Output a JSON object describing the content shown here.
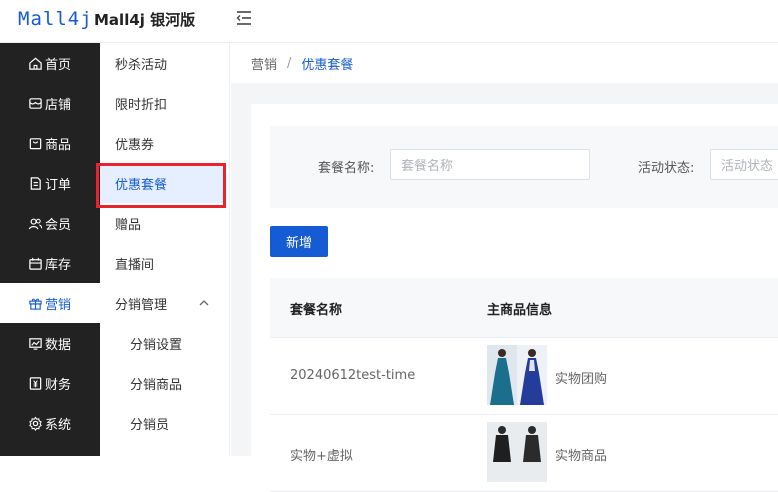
{
  "header": {
    "logo": "Mall4j",
    "title": "Mall4j 银河版"
  },
  "sidebar_main": [
    {
      "label": "首页",
      "icon": "home-icon"
    },
    {
      "label": "店铺",
      "icon": "store-icon"
    },
    {
      "label": "商品",
      "icon": "goods-icon"
    },
    {
      "label": "订单",
      "icon": "order-icon"
    },
    {
      "label": "会员",
      "icon": "member-icon"
    },
    {
      "label": "库存",
      "icon": "inventory-icon"
    },
    {
      "label": "营销",
      "icon": "gift-icon",
      "active": true
    },
    {
      "label": "数据",
      "icon": "chart-icon"
    },
    {
      "label": "财务",
      "icon": "finance-icon"
    },
    {
      "label": "系统",
      "icon": "settings-icon"
    }
  ],
  "sidebar_sub": [
    {
      "label": "秒杀活动"
    },
    {
      "label": "限时折扣"
    },
    {
      "label": "优惠券"
    },
    {
      "label": "优惠套餐",
      "active": true
    },
    {
      "label": "赠品"
    },
    {
      "label": "直播间"
    },
    {
      "label": "分销管理",
      "expanded": true
    },
    {
      "label": "分销设置",
      "sub": true
    },
    {
      "label": "分销商品",
      "sub": true
    },
    {
      "label": "分销员",
      "sub": true
    }
  ],
  "breadcrumb": {
    "parent": "营销",
    "separator": "/",
    "current": "优惠套餐"
  },
  "search": {
    "name_label": "套餐名称:",
    "name_placeholder": "套餐名称",
    "status_label": "活动状态:",
    "status_placeholder": "活动状态"
  },
  "add_button": "新增",
  "table": {
    "columns": [
      "套餐名称",
      "主商品信息"
    ],
    "rows": [
      {
        "name": "20240612test-time",
        "product_type": "实物团购"
      },
      {
        "name": "实物+虚拟",
        "product_type": "实物商品"
      }
    ]
  },
  "colors": {
    "primary": "#155bd4",
    "sidebar_bg": "#222222",
    "highlight": "#e8232d"
  }
}
